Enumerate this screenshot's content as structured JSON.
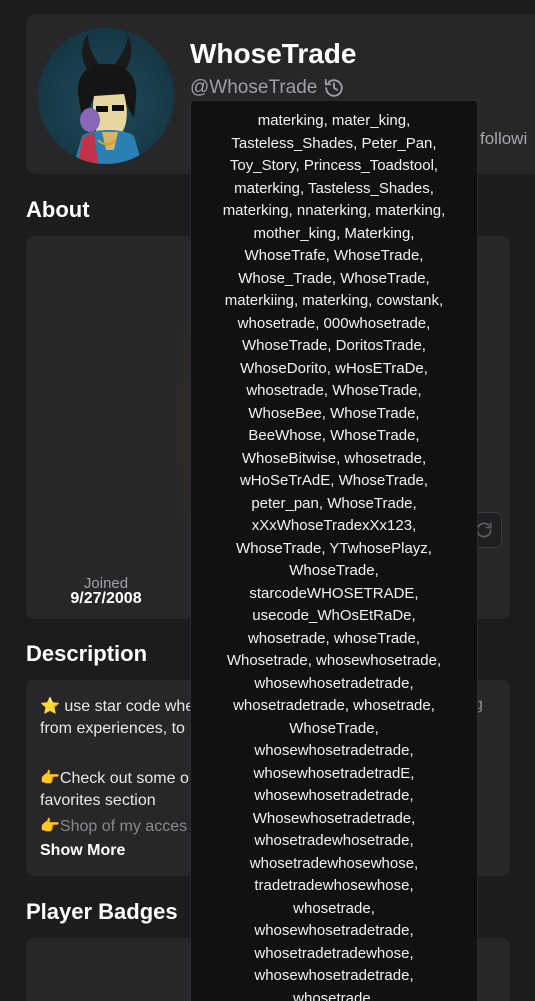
{
  "profile": {
    "display_name": "WhoseTrade",
    "username": "@WhoseTrade",
    "following_fragment": "followi"
  },
  "icons": {
    "history": "history-icon",
    "refresh": "refresh-icon",
    "star": "star-emoji",
    "pointing_hand": "pointing-hand-emoji"
  },
  "sections": {
    "about": "About",
    "description": "Description",
    "player_badges": "Player Badges"
  },
  "about": {
    "joined_label": "Joined",
    "joined_value": "9/27/2008"
  },
  "description": {
    "line1": "⭐ use star code whe",
    "line1_fragment": "g",
    "line2": "from experiences, to",
    "line3": "👉Check out some o",
    "line4": "favorites section",
    "line5": "👉Shop of my acces",
    "show_more": "Show More"
  },
  "previous_usernames": [
    "materking, mater_king,",
    "Tasteless_Shades, Peter_Pan,",
    "Toy_Story, Princess_Toadstool,",
    "materking, Tasteless_Shades,",
    "materking, nnaterking, materking,",
    "mother_king, Materking,",
    "WhoseTrafe, WhoseTrade,",
    "Whose_Trade, WhoseTrade,",
    "materkiing, materking, cowstank,",
    "whosetrade, 000whosetrade,",
    "WhoseTrade, DoritosTrade,",
    "WhoseDorito, wHosETraDe,",
    "whosetrade, WhoseTrade,",
    "WhoseBee, WhoseTrade,",
    "BeeWhose, WhoseTrade,",
    "WhoseBitwise, whosetrade,",
    "wHoSeTrAdE, WhoseTrade,",
    "peter_pan, WhoseTrade,",
    "xXxWhoseTradexXx123,",
    "WhoseTrade, YTwhosePlayz,",
    "WhoseTrade,",
    "starcodeWHOSETRADE,",
    "usecode_WhOsEtRaDe,",
    "whosetrade, whoseTrade,",
    "Whosetrade, whosewhosetrade,",
    "whosewhosetradetrade,",
    "whosetradetrade, whosetrade,",
    "WhoseTrade,",
    "whosewhosetradetrade,",
    "whosewhosetradetradE,",
    "whosewhosetradetrade,",
    "Whosewhosetradetrade,",
    "whosetradewhosetrade,",
    "whosetradewhosewhose,",
    "tradetradewhosewhose,",
    "whosetrade,",
    "whosewhosetradetrade,",
    "whosetradetradewhose,",
    "whosewhosetradetrade,",
    "whosetrade,"
  ]
}
